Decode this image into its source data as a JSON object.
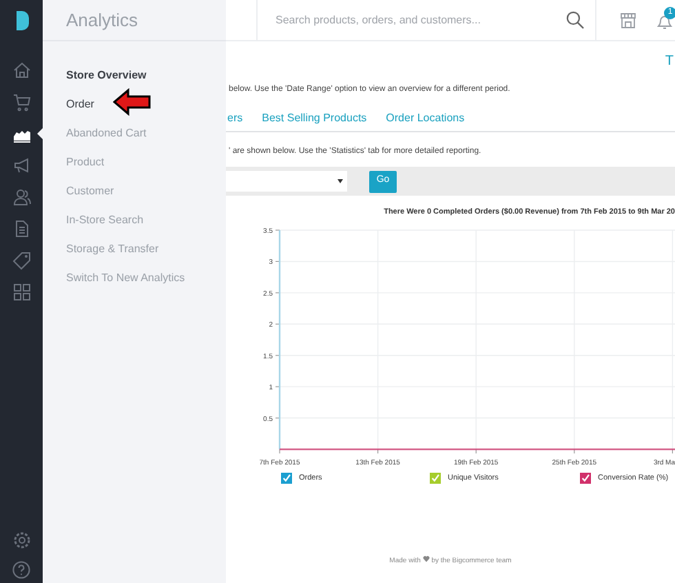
{
  "sidebar": {
    "title": "Analytics",
    "items": [
      {
        "label": "Store Overview",
        "selected": true,
        "hovered": false
      },
      {
        "label": "Order",
        "selected": false,
        "hovered": true
      },
      {
        "label": "Abandoned Cart",
        "selected": false,
        "hovered": false
      },
      {
        "label": "Product",
        "selected": false,
        "hovered": false
      },
      {
        "label": "Customer",
        "selected": false,
        "hovered": false
      },
      {
        "label": "In-Store Search",
        "selected": false,
        "hovered": false
      },
      {
        "label": "Storage & Transfer",
        "selected": false,
        "hovered": false
      },
      {
        "label": "Switch To New Analytics",
        "selected": false,
        "hovered": false
      }
    ]
  },
  "nav_icons": [
    {
      "kind": "home",
      "selected": false
    },
    {
      "kind": "cart",
      "selected": false
    },
    {
      "kind": "analytics",
      "selected": true
    },
    {
      "kind": "megaphone",
      "selected": false
    },
    {
      "kind": "customers",
      "selected": false
    },
    {
      "kind": "document",
      "selected": false
    },
    {
      "kind": "tag",
      "selected": false
    },
    {
      "kind": "apps",
      "selected": false
    }
  ],
  "header": {
    "search_placeholder": "Search products, orders, and customers...",
    "notification_count": "1"
  },
  "content": {
    "corner_link": "T",
    "intro": "below. Use the 'Date Range' option to view an overview for a different period.",
    "tabs": [
      "ers",
      "Best Selling Products",
      "Order Locations"
    ],
    "note": "' are shown below. Use the 'Statistics' tab for more detailed reporting.",
    "go_button": "Go"
  },
  "chart": {
    "chart_data": {
      "type": "line",
      "title": "There Were 0 Completed Orders ($0.00 Revenue) from 7th Feb 2015 to 9th Mar 20",
      "categories": [
        "7th Feb 2015",
        "13th Feb 2015",
        "19th Feb 2015",
        "25th Feb 2015",
        "3rd Ma"
      ],
      "ylim": [
        0,
        3.5
      ],
      "yticks": [
        0.5,
        1,
        1.5,
        2,
        2.5,
        3,
        3.5
      ],
      "series": [
        {
          "name": "Orders",
          "color": "#1b9fd0",
          "values": [
            null,
            null,
            null,
            null,
            null
          ]
        },
        {
          "name": "Unique Visitors",
          "color": "#a6cd2c",
          "values": [
            null,
            null,
            null,
            null,
            null
          ]
        },
        {
          "name": "Conversion Rate (%)",
          "color": "#d1316b",
          "values": [
            0,
            0,
            0,
            0,
            0
          ]
        }
      ],
      "grid": true
    },
    "legend": [
      {
        "checked": true
      },
      {
        "checked": true
      },
      {
        "checked": true
      }
    ]
  },
  "footer": {
    "before": "Made with",
    "after": "by the Bigcommerce team"
  }
}
